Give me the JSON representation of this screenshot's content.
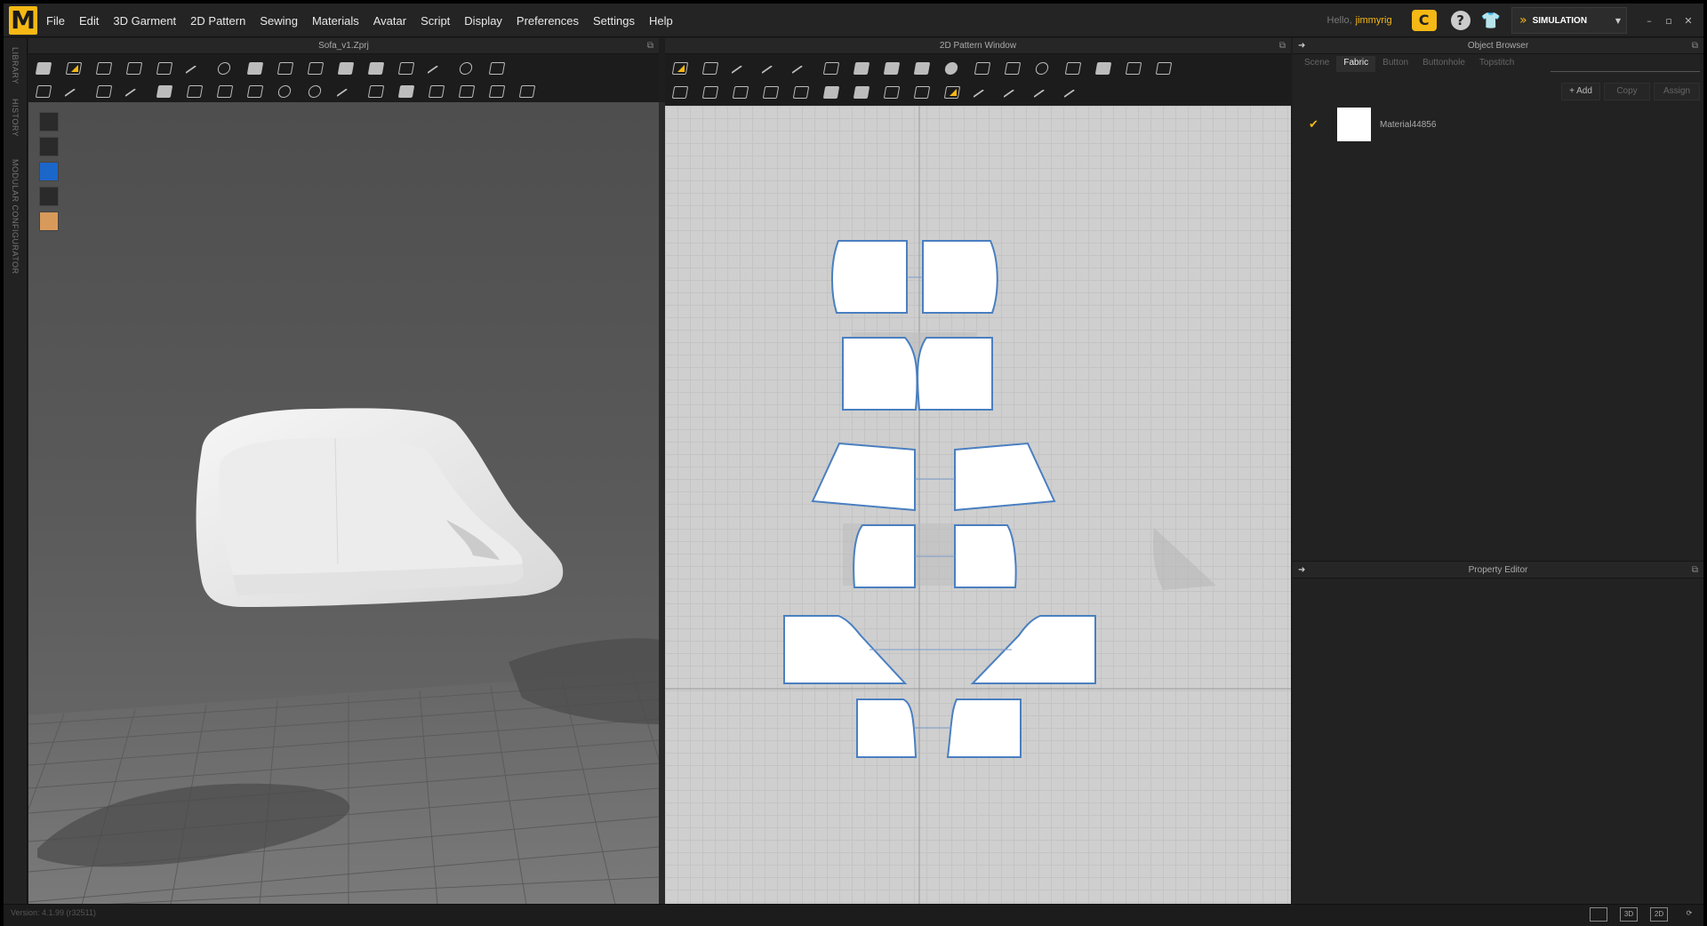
{
  "app": {
    "logo": "M",
    "menus": [
      "File",
      "Edit",
      "3D Garment",
      "2D Pattern",
      "Sewing",
      "Materials",
      "Avatar",
      "Script",
      "Display",
      "Preferences",
      "Settings",
      "Help"
    ],
    "greeting": "Hello,",
    "username": "jimmyrig",
    "cloud_icon": "cloud-c",
    "help_label": "?",
    "mode_label": "SIMULATION",
    "window_controls": [
      "–",
      "▫",
      "✕"
    ]
  },
  "left_tabs": [
    "LIBRARY",
    "HISTORY",
    "MODULAR CONFIGURATOR"
  ],
  "view3d": {
    "title": "Sofa_v1.Zprj"
  },
  "view2d": {
    "title": "2D Pattern Window"
  },
  "object_browser": {
    "title": "Object Browser",
    "tabs": [
      "Scene",
      "Fabric",
      "Button",
      "Buttonhole",
      "Topstitch"
    ],
    "active_tab": "Fabric",
    "actions": [
      "+ Add",
      "Copy",
      "Assign"
    ],
    "materials": [
      {
        "name": "Material44856",
        "checked": true
      }
    ]
  },
  "property_editor": {
    "title": "Property Editor"
  },
  "status": {
    "version": "Version: 4.1.99 (r32511)",
    "view_buttons": [
      "",
      "3D",
      "2D"
    ],
    "refresh": "⟳"
  },
  "colors": {
    "accent": "#f5b815",
    "pattern_outline": "#4a7fc0"
  }
}
